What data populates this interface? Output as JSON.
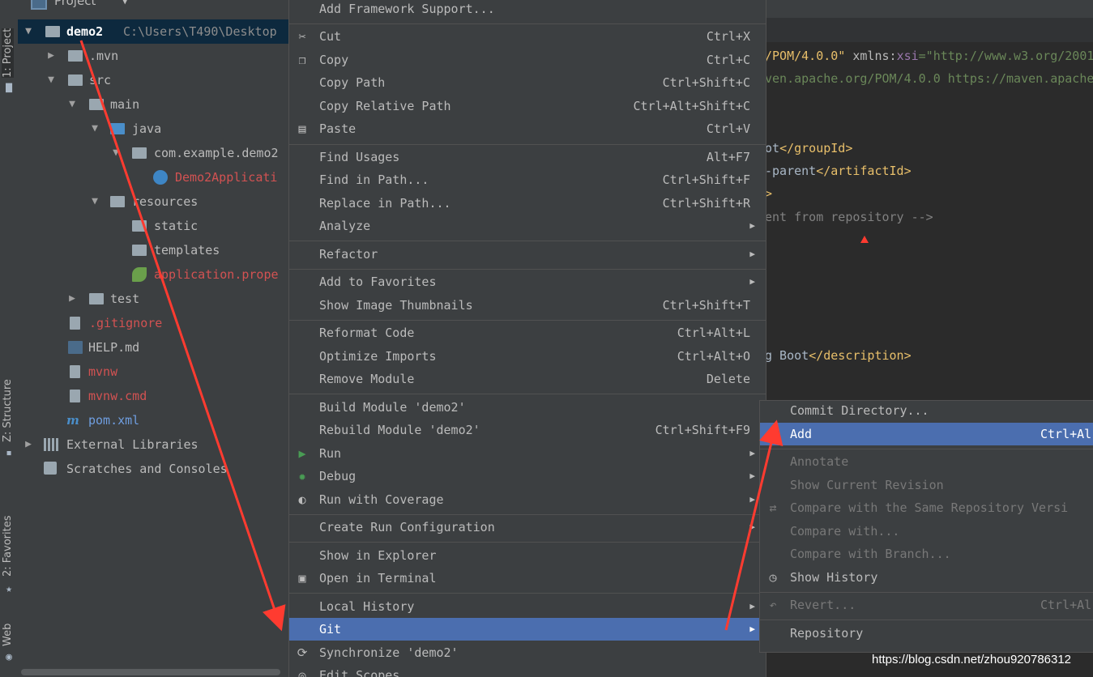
{
  "left_strip": {
    "project_label": "1: Project",
    "structure_label": "Z: Structure",
    "favorites_label": "2: Favorites",
    "web_label": "Web"
  },
  "project_panel": {
    "title": "Project",
    "tree": [
      {
        "label": "demo2",
        "path": "C:\\Users\\T490\\Desktop",
        "selected": true
      },
      {
        "label": ".mvn"
      },
      {
        "label": "src"
      },
      {
        "label": "main"
      },
      {
        "label": "java"
      },
      {
        "label": "com.example.demo2"
      },
      {
        "label": "Demo2Applicati"
      },
      {
        "label": "resources"
      },
      {
        "label": "static"
      },
      {
        "label": "templates"
      },
      {
        "label": "application.prope"
      },
      {
        "label": "test"
      },
      {
        "label": ".gitignore"
      },
      {
        "label": "HELP.md"
      },
      {
        "label": "mvnw"
      },
      {
        "label": "mvnw.cmd"
      },
      {
        "label": "pom.xml"
      },
      {
        "label": "External Libraries"
      },
      {
        "label": "Scratches and Consoles"
      }
    ]
  },
  "editor": {
    "line1_tag": "/POM/4.0.0\"",
    "line1_attr": " xmlns:",
    "line1_ns": "xsi",
    "line1_str": "=\"http://www.w3.org/2001",
    "line2": "ven.apache.org/POM/4.0.0 https://maven.apache.",
    "line3_txt": "ot",
    "line3_tag": "</groupId>",
    "line4_txt": "-parent",
    "line4_tag": "</artifactId>",
    "line5_tag": ">",
    "line6": "ent from repository -->",
    "line7_txt": "g Boot",
    "line7_tag": "</description>"
  },
  "context_menu": {
    "items": [
      {
        "label": "Add Framework Support...",
        "shortcut": ""
      },
      {
        "label": "Cut",
        "shortcut": "Ctrl+X"
      },
      {
        "label": "Copy",
        "shortcut": "Ctrl+C"
      },
      {
        "label": "Copy Path",
        "shortcut": "Ctrl+Shift+C"
      },
      {
        "label": "Copy Relative Path",
        "shortcut": "Ctrl+Alt+Shift+C"
      },
      {
        "label": "Paste",
        "shortcut": "Ctrl+V"
      },
      {
        "label": "Find Usages",
        "shortcut": "Alt+F7"
      },
      {
        "label": "Find in Path...",
        "shortcut": "Ctrl+Shift+F"
      },
      {
        "label": "Replace in Path...",
        "shortcut": "Ctrl+Shift+R"
      },
      {
        "label": "Analyze",
        "shortcut": ""
      },
      {
        "label": "Refactor",
        "shortcut": ""
      },
      {
        "label": "Add to Favorites",
        "shortcut": ""
      },
      {
        "label": "Show Image Thumbnails",
        "shortcut": "Ctrl+Shift+T"
      },
      {
        "label": "Reformat Code",
        "shortcut": "Ctrl+Alt+L"
      },
      {
        "label": "Optimize Imports",
        "shortcut": "Ctrl+Alt+O"
      },
      {
        "label": "Remove Module",
        "shortcut": "Delete"
      },
      {
        "label": "Build Module 'demo2'",
        "shortcut": ""
      },
      {
        "label": "Rebuild Module 'demo2'",
        "shortcut": "Ctrl+Shift+F9"
      },
      {
        "label": "Run",
        "shortcut": ""
      },
      {
        "label": "Debug",
        "shortcut": ""
      },
      {
        "label": "Run with Coverage",
        "shortcut": ""
      },
      {
        "label": "Create Run Configuration",
        "shortcut": ""
      },
      {
        "label": "Show in Explorer",
        "shortcut": ""
      },
      {
        "label": "Open in Terminal",
        "shortcut": ""
      },
      {
        "label": "Local History",
        "shortcut": ""
      },
      {
        "label": "Git",
        "shortcut": ""
      },
      {
        "label": "Synchronize 'demo2'",
        "shortcut": ""
      },
      {
        "label": "Edit Scopes...",
        "shortcut": ""
      }
    ]
  },
  "git_submenu": {
    "items": [
      {
        "label": "Commit Directory...",
        "shortcut": ""
      },
      {
        "label": "Add",
        "shortcut": "Ctrl+Al"
      },
      {
        "label": "Annotate",
        "shortcut": ""
      },
      {
        "label": "Show Current Revision",
        "shortcut": ""
      },
      {
        "label": "Compare with the Same Repository Versi",
        "shortcut": ""
      },
      {
        "label": "Compare with...",
        "shortcut": ""
      },
      {
        "label": "Compare with Branch...",
        "shortcut": ""
      },
      {
        "label": "Show History",
        "shortcut": ""
      },
      {
        "label": "Revert...",
        "shortcut": "Ctrl+Al"
      },
      {
        "label": "Repository",
        "shortcut": ""
      }
    ]
  },
  "watermark": "https://blog.csdn.net/zhou920786312",
  "colors": {
    "menu_bg": "#3c3f41",
    "highlight": "#4b6eaf",
    "annotation_arrow": "#ff3b30"
  }
}
